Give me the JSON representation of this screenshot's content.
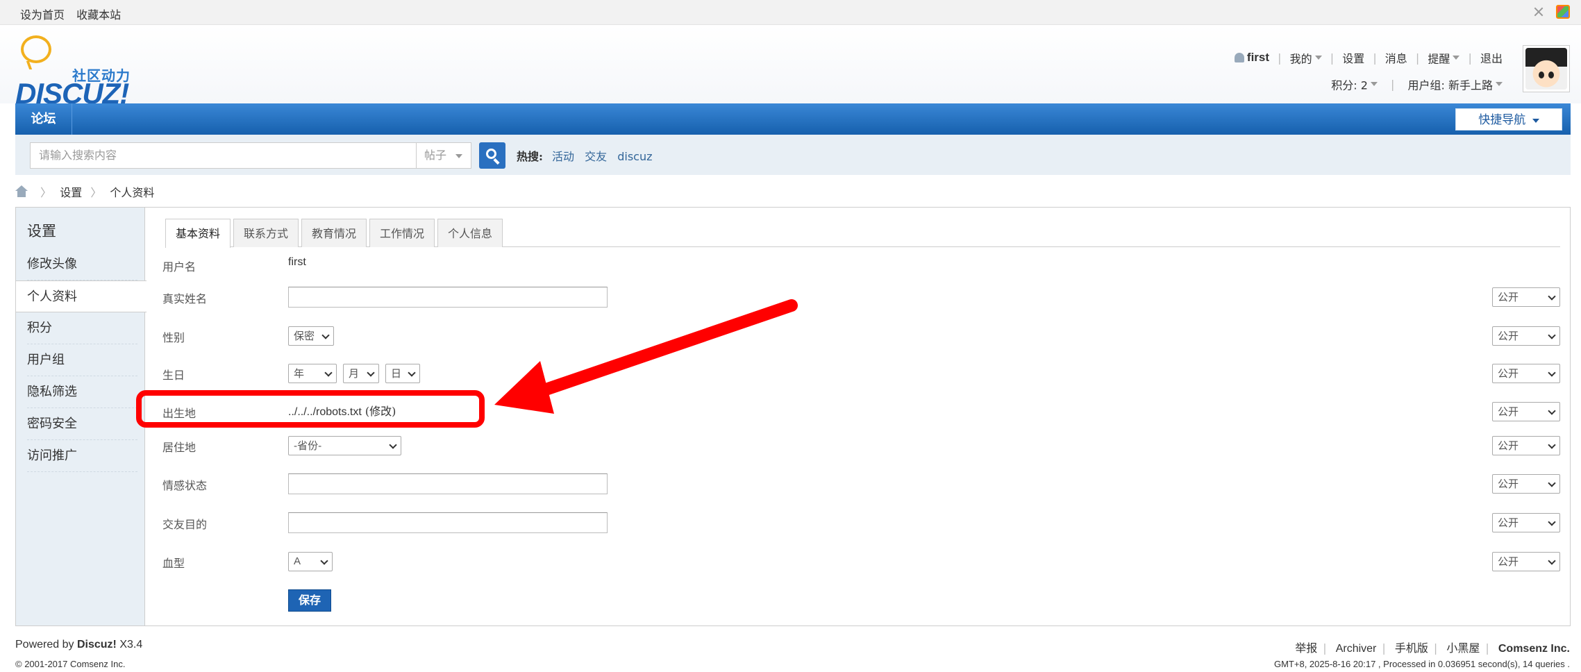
{
  "topbar": {
    "set_home": "设为首页",
    "bookmark": "收藏本站",
    "icons": [
      "expand-icon",
      "color-scheme-icon"
    ]
  },
  "logo": {
    "slogan": "社区动力",
    "word": "DISCUZ!"
  },
  "user": {
    "name": "first",
    "mine": "我的",
    "settings": "设置",
    "messages": "消息",
    "alerts": "提醒",
    "logout": "退出",
    "credits": "积分: 2",
    "group": "用户组: 新手上路"
  },
  "nav": {
    "forum": "论坛",
    "quick_nav": "快捷导航"
  },
  "search": {
    "placeholder": "请输入搜索内容",
    "type": "帖子",
    "hot_label": "热搜:",
    "hot_terms": [
      "活动",
      "交友",
      "discuz"
    ]
  },
  "breadcrumb": [
    "设置",
    "个人资料"
  ],
  "sidebar": {
    "title": "设置",
    "items": [
      "修改头像",
      "个人资料",
      "积分",
      "用户组",
      "隐私筛选",
      "密码安全",
      "访问推广"
    ],
    "active_index": 1
  },
  "tabs": [
    "基本资料",
    "联系方式",
    "教育情况",
    "工作情况",
    "个人信息"
  ],
  "form": {
    "username_label": "用户名",
    "username_value": "first",
    "realname_label": "真实姓名",
    "gender_label": "性别",
    "gender_value": "保密",
    "birthday_label": "生日",
    "birth_year": "年",
    "birth_month": "月",
    "birth_day": "日",
    "birthplace_label": "出生地",
    "birthplace_value": "../../../robots.txt",
    "birthplace_edit": "(修改)",
    "residence_label": "居住地",
    "residence_value": "-省份-",
    "affective_label": "情感状态",
    "lookingfor_label": "交友目的",
    "bloodtype_label": "血型",
    "bloodtype_value": "A",
    "privacy_value": "公开",
    "save_label": "保存"
  },
  "footer": {
    "powered": "Powered by",
    "brand": "Discuz!",
    "version": "X3.4",
    "copyright": "© 2001-2017 Comsenz Inc.",
    "links": [
      "举报",
      "Archiver",
      "手机版",
      "小黑屋"
    ],
    "company": "Comsenz Inc.",
    "stats": "GMT+8, 2025-8-16 20:17 , Processed in 0.036951 second(s), 14 queries ."
  },
  "colors": {
    "nav_blue": "#1660ad",
    "sidebar_bg": "#e8eff5",
    "annotation_red": "#ff0000"
  }
}
